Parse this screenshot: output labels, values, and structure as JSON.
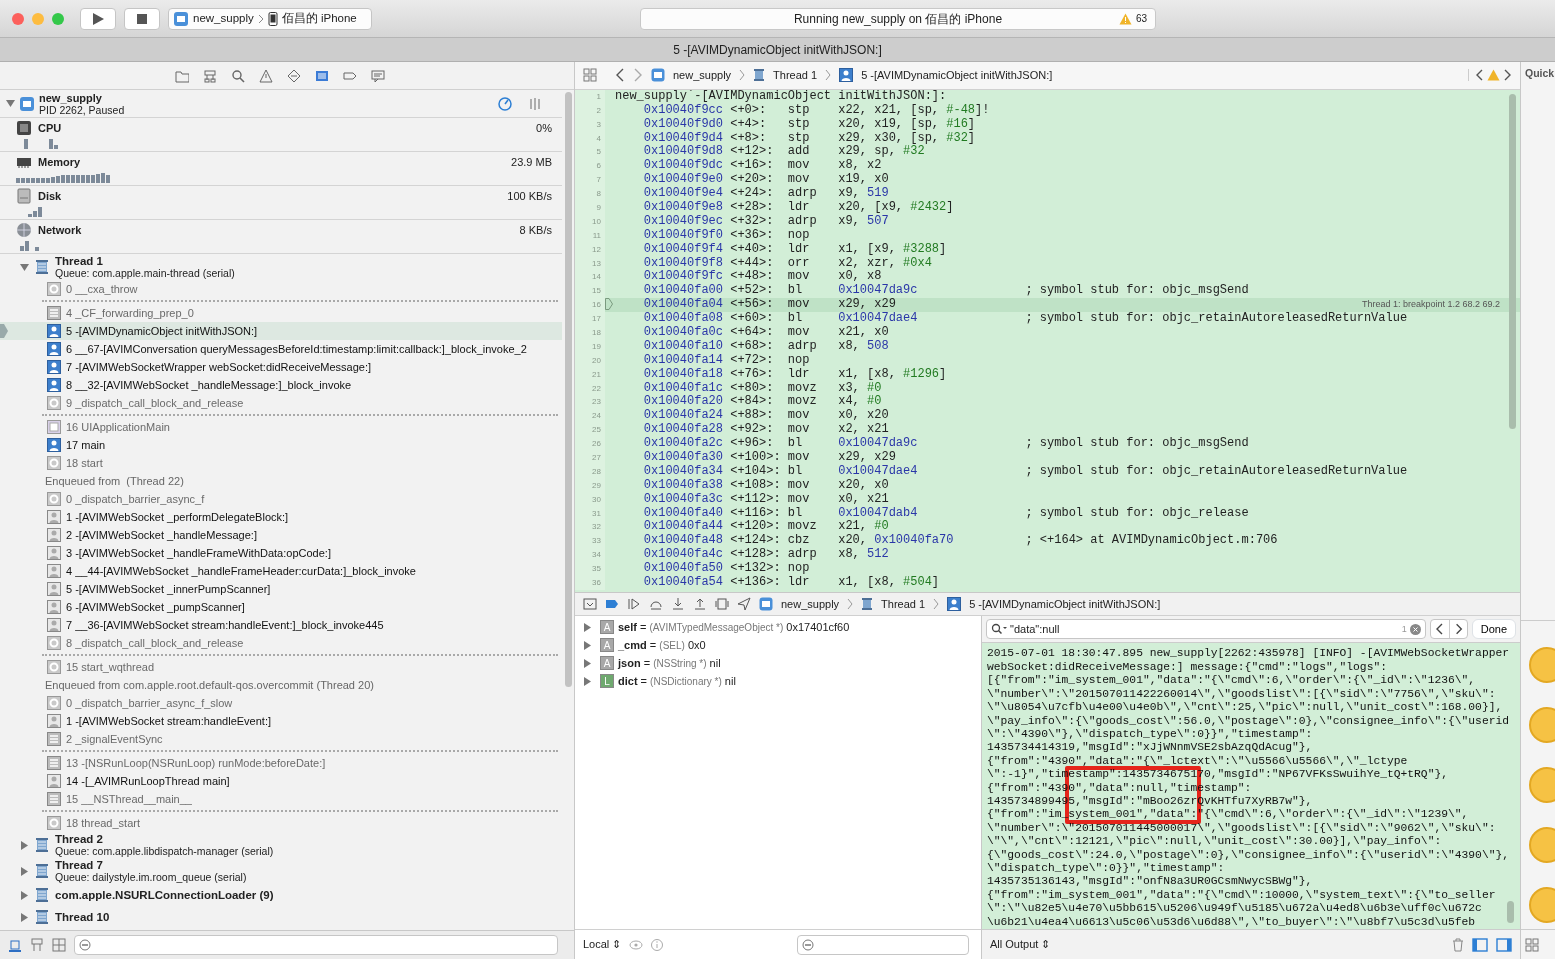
{
  "toolbar": {
    "scheme": "new_supply",
    "device": "佰昌的 iPhone",
    "activity": "Running new_supply on 佰昌的 iPhone",
    "warning_count": "63"
  },
  "tab_title": "5 -[AVIMDynamicObject initWithJSON:]",
  "navigator": {
    "process": {
      "name": "new_supply",
      "status": "PID 2262, Paused",
      "expanded": true
    },
    "gauges": [
      {
        "kind": "cpu",
        "label": "CPU",
        "reading": "0%"
      },
      {
        "kind": "memory",
        "label": "Memory",
        "reading": "23.9 MB"
      },
      {
        "kind": "disk",
        "label": "Disk",
        "reading": "100 KB/s"
      },
      {
        "kind": "network",
        "label": "Network",
        "reading": "8 KB/s"
      }
    ],
    "threads": [
      {
        "title": "Thread 1",
        "queue": "Queue: com.apple.main-thread (serial)",
        "expanded": true,
        "sections": [
          {
            "frames": [
              {
                "label": "0 __cxa_throw",
                "kind": "system",
                "selected": false,
                "gap_before": false
              },
              {
                "label": "4 _CF_forwarding_prep_0",
                "kind": "framework",
                "selected": false,
                "gap_before": true
              },
              {
                "label": "5 -[AVIMDynamicObject initWithJSON:]",
                "kind": "user",
                "selected": true,
                "gap_before": false
              },
              {
                "label": "6 __67-[AVIMConversation queryMessagesBeforeId:timestamp:limit:callback:]_block_invoke_2",
                "kind": "user",
                "selected": false,
                "gap_before": false
              },
              {
                "label": "7 -[AVIMWebSocketWrapper webSocket:didReceiveMessage:]",
                "kind": "user",
                "selected": false,
                "gap_before": false
              },
              {
                "label": "8 __32-[AVIMWebSocket _handleMessage:]_block_invoke",
                "kind": "user",
                "selected": false,
                "gap_before": false
              },
              {
                "label": "9 _dispatch_call_block_and_release",
                "kind": "system",
                "selected": false,
                "gap_before": false
              },
              {
                "label": "16 UIApplicationMain",
                "kind": "app",
                "selected": false,
                "gap_before": true
              },
              {
                "label": "17 main",
                "kind": "user",
                "selected": false,
                "gap_before": false
              },
              {
                "label": "18 start",
                "kind": "system",
                "selected": false,
                "gap_before": false
              }
            ]
          },
          {
            "heading": "Enqueued from  (Thread 22)",
            "frames": [
              {
                "label": "0 _dispatch_barrier_async_f",
                "kind": "system",
                "selected": false,
                "gap_before": false
              },
              {
                "label": "1 -[AVIMWebSocket _performDelegateBlock:]",
                "kind": "user",
                "selected": false,
                "gap_before": false
              },
              {
                "label": "2 -[AVIMWebSocket _handleMessage:]",
                "kind": "user",
                "selected": false,
                "gap_before": false
              },
              {
                "label": "3 -[AVIMWebSocket _handleFrameWithData:opCode:]",
                "kind": "user",
                "selected": false,
                "gap_before": false
              },
              {
                "label": "4 __44-[AVIMWebSocket _handleFrameHeader:curData:]_block_invoke",
                "kind": "user",
                "selected": false,
                "gap_before": false
              },
              {
                "label": "5 -[AVIMWebSocket _innerPumpScanner]",
                "kind": "user",
                "selected": false,
                "gap_before": false
              },
              {
                "label": "6 -[AVIMWebSocket _pumpScanner]",
                "kind": "user",
                "selected": false,
                "gap_before": false
              },
              {
                "label": "7 __36-[AVIMWebSocket stream:handleEvent:]_block_invoke445",
                "kind": "user",
                "selected": false,
                "gap_before": false
              },
              {
                "label": "8 _dispatch_call_block_and_release",
                "kind": "system",
                "selected": false,
                "gap_before": false
              },
              {
                "label": "15 start_wqthread",
                "kind": "system",
                "selected": false,
                "gap_before": true
              }
            ]
          },
          {
            "heading": "Enqueued from com.apple.root.default-qos.overcommit (Thread 20)",
            "frames": [
              {
                "label": "0 _dispatch_barrier_async_f_slow",
                "kind": "system",
                "selected": false,
                "gap_before": false
              },
              {
                "label": "1 -[AVIMWebSocket stream:handleEvent:]",
                "kind": "user",
                "selected": false,
                "gap_before": false
              },
              {
                "label": "2 _signalEventSync",
                "kind": "framework",
                "selected": false,
                "gap_before": false
              },
              {
                "label": "13 -[NSRunLoop(NSRunLoop) runMode:beforeDate:]",
                "kind": "framework",
                "selected": false,
                "gap_before": true
              },
              {
                "label": "14 -[_AVIMRunLoopThread main]",
                "kind": "user",
                "selected": false,
                "gap_before": false
              },
              {
                "label": "15 __NSThread__main__",
                "kind": "framework",
                "selected": false,
                "gap_before": false
              },
              {
                "label": "18 thread_start",
                "kind": "system",
                "selected": false,
                "gap_before": true
              }
            ]
          }
        ]
      },
      {
        "title": "Thread 2",
        "queue": "Queue: com.apple.libdispatch-manager (serial)",
        "expanded": false
      },
      {
        "title": "Thread 7",
        "queue": "Queue: dailystyle.im.room_queue (serial)",
        "expanded": false
      },
      {
        "title": "com.apple.NSURLConnectionLoader (9)",
        "expanded": false
      },
      {
        "title": "Thread 10",
        "expanded": false
      }
    ]
  },
  "jump_bar": [
    "new_supply",
    "Thread 1",
    "5 -[AVIMDynamicObject initWithJSON:]"
  ],
  "disassembly": {
    "lines": [
      {
        "n": "1",
        "kind": "label",
        "text": "new_supply`-[AVIMDynamicObject initWithJSON:]:",
        "current": false
      },
      {
        "n": "2",
        "kind": "instr",
        "addr": "0x10040f9cc",
        "off": "<+0>:",
        "op": "stp",
        "args": "x22, x21, [sp, #-48]!",
        "current": false
      },
      {
        "n": "3",
        "kind": "instr",
        "addr": "0x10040f9d0",
        "off": "<+4>:",
        "op": "stp",
        "args": "x20, x19, [sp, #16]",
        "current": false
      },
      {
        "n": "4",
        "kind": "instr",
        "addr": "0x10040f9d4",
        "off": "<+8>:",
        "op": "stp",
        "args": "x29, x30, [sp, #32]",
        "current": false
      },
      {
        "n": "5",
        "kind": "instr",
        "addr": "0x10040f9d8",
        "off": "<+12>:",
        "op": "add",
        "args": "x29, sp, #32",
        "current": false
      },
      {
        "n": "6",
        "kind": "instr",
        "addr": "0x10040f9dc",
        "off": "<+16>:",
        "op": "mov",
        "args": "x8, x2",
        "current": false
      },
      {
        "n": "7",
        "kind": "instr",
        "addr": "0x10040f9e0",
        "off": "<+20>:",
        "op": "mov",
        "args": "x19, x0",
        "current": false
      },
      {
        "n": "8",
        "kind": "instr",
        "addr": "0x10040f9e4",
        "off": "<+24>:",
        "op": "adrp",
        "args": "x9, 519",
        "current": false
      },
      {
        "n": "9",
        "kind": "instr",
        "addr": "0x10040f9e8",
        "off": "<+28>:",
        "op": "ldr",
        "args": "x20, [x9, #2432]",
        "current": false
      },
      {
        "n": "10",
        "kind": "instr",
        "addr": "0x10040f9ec",
        "off": "<+32>:",
        "op": "adrp",
        "args": "x9, 507",
        "current": false
      },
      {
        "n": "11",
        "kind": "instr",
        "addr": "0x10040f9f0",
        "off": "<+36>:",
        "op": "nop",
        "current": false
      },
      {
        "n": "12",
        "kind": "instr",
        "addr": "0x10040f9f4",
        "off": "<+40>:",
        "op": "ldr",
        "args": "x1, [x9, #3288]",
        "current": false
      },
      {
        "n": "13",
        "kind": "instr",
        "addr": "0x10040f9f8",
        "off": "<+44>:",
        "op": "orr",
        "args": "x2, xzr, #0x4",
        "current": false
      },
      {
        "n": "14",
        "kind": "instr",
        "addr": "0x10040f9fc",
        "off": "<+48>:",
        "op": "mov",
        "args": "x0, x8",
        "current": false
      },
      {
        "n": "15",
        "kind": "instr",
        "addr": "0x10040fa00",
        "off": "<+52>:",
        "op": "bl",
        "args": "0x10047da9c",
        "comment": "; symbol stub for: objc_msgSend",
        "current": false
      },
      {
        "n": "16",
        "kind": "instr",
        "addr": "0x10040fa04",
        "off": "<+56>:",
        "op": "mov",
        "args": "x29, x29",
        "current": true,
        "annotation": "Thread 1: breakpoint 1.2 68.2 69.2"
      },
      {
        "n": "17",
        "kind": "instr",
        "addr": "0x10040fa08",
        "off": "<+60>:",
        "op": "bl",
        "args": "0x10047dae4",
        "comment": "; symbol stub for: objc_retainAutoreleasedReturnValue",
        "current": false
      },
      {
        "n": "18",
        "kind": "instr",
        "addr": "0x10040fa0c",
        "off": "<+64>:",
        "op": "mov",
        "args": "x21, x0",
        "current": false
      },
      {
        "n": "19",
        "kind": "instr",
        "addr": "0x10040fa10",
        "off": "<+68>:",
        "op": "adrp",
        "args": "x8, 508",
        "current": false
      },
      {
        "n": "20",
        "kind": "instr",
        "addr": "0x10040fa14",
        "off": "<+72>:",
        "op": "nop",
        "current": false
      },
      {
        "n": "21",
        "kind": "instr",
        "addr": "0x10040fa18",
        "off": "<+76>:",
        "op": "ldr",
        "args": "x1, [x8, #1296]",
        "current": false
      },
      {
        "n": "22",
        "kind": "instr",
        "addr": "0x10040fa1c",
        "off": "<+80>:",
        "op": "movz",
        "args": "x3, #0",
        "current": false
      },
      {
        "n": "23",
        "kind": "instr",
        "addr": "0x10040fa20",
        "off": "<+84>:",
        "op": "movz",
        "args": "x4, #0",
        "current": false
      },
      {
        "n": "24",
        "kind": "instr",
        "addr": "0x10040fa24",
        "off": "<+88>:",
        "op": "mov",
        "args": "x0, x20",
        "current": false
      },
      {
        "n": "25",
        "kind": "instr",
        "addr": "0x10040fa28",
        "off": "<+92>:",
        "op": "mov",
        "args": "x2, x21",
        "current": false
      },
      {
        "n": "26",
        "kind": "instr",
        "addr": "0x10040fa2c",
        "off": "<+96>:",
        "op": "bl",
        "args": "0x10047da9c",
        "comment": "; symbol stub for: objc_msgSend",
        "current": false
      },
      {
        "n": "27",
        "kind": "instr",
        "addr": "0x10040fa30",
        "off": "<+100>:",
        "op": "mov",
        "args": "x29, x29",
        "current": false
      },
      {
        "n": "28",
        "kind": "instr",
        "addr": "0x10040fa34",
        "off": "<+104>:",
        "op": "bl",
        "args": "0x10047dae4",
        "comment": "; symbol stub for: objc_retainAutoreleasedReturnValue",
        "current": false
      },
      {
        "n": "29",
        "kind": "instr",
        "addr": "0x10040fa38",
        "off": "<+108>:",
        "op": "mov",
        "args": "x20, x0",
        "current": false
      },
      {
        "n": "30",
        "kind": "instr",
        "addr": "0x10040fa3c",
        "off": "<+112>:",
        "op": "mov",
        "args": "x0, x21",
        "current": false
      },
      {
        "n": "31",
        "kind": "instr",
        "addr": "0x10040fa40",
        "off": "<+116>:",
        "op": "bl",
        "args": "0x10047dab4",
        "comment": "; symbol stub for: objc_release",
        "current": false
      },
      {
        "n": "32",
        "kind": "instr",
        "addr": "0x10040fa44",
        "off": "<+120>:",
        "op": "movz",
        "args": "x21, #0",
        "current": false
      },
      {
        "n": "33",
        "kind": "instr",
        "addr": "0x10040fa48",
        "off": "<+124>:",
        "op": "cbz",
        "args": "x20, 0x10040fa70",
        "comment": "; <+164> at AVIMDynamicObject.m:706",
        "current": false
      },
      {
        "n": "34",
        "kind": "instr",
        "addr": "0x10040fa4c",
        "off": "<+128>:",
        "op": "adrp",
        "args": "x8, 512",
        "current": false
      },
      {
        "n": "35",
        "kind": "instr",
        "addr": "0x10040fa50",
        "off": "<+132>:",
        "op": "nop",
        "current": false
      },
      {
        "n": "36",
        "kind": "instr",
        "addr": "0x10040fa54",
        "off": "<+136>:",
        "op": "ldr",
        "args": "x1, [x8, #504]",
        "current": false
      }
    ]
  },
  "debug_bar": {
    "path": [
      "new_supply",
      "Thread 1",
      "5 -[AVIMDynamicObject initWithJSON:]"
    ]
  },
  "variables": [
    {
      "kind": "argument",
      "badge": "A",
      "name": "self",
      "assign": "=",
      "type": "(AVIMTypedMessageObject *)",
      "value": "0x17401cf60"
    },
    {
      "kind": "argument",
      "badge": "A",
      "name": "_cmd",
      "assign": "=",
      "type": "(SEL)",
      "value": "0x0"
    },
    {
      "kind": "argument",
      "badge": "A",
      "name": "json",
      "assign": "=",
      "type": "(NSString *)",
      "value": "nil"
    },
    {
      "kind": "local",
      "badge": "L",
      "name": "dict",
      "assign": "=",
      "type": "(NSDictionary *)",
      "value": "nil"
    }
  ],
  "variables_scope": "Local ⇕",
  "console": {
    "search": "\"data\":null",
    "match_count": "1",
    "done": "Done",
    "output_filter": "All Output ⇕",
    "lines": [
      "2015-07-01 18:30:47.895 new_supply[2262:435978] [INFO] -[AVIMWebSocketWrapper",
      "webSocket:didReceiveMessage:] message:{\"cmd\":\"logs\",\"logs\":",
      "[{\"from\":\"im_system_001\",\"data\":\"{\\\"cmd\\\":6,\\\"order\\\":{\\\"_id\\\":\\\"1236\\\",",
      "\\\"number\\\":\\\"201507011422260014\\\",\\\"goodslist\\\":[{\\\"sid\\\":\\\"7756\\\",\\\"sku\\\":",
      "\\\"\\u8054\\u7cfb\\u4e00\\u4e0b\\\",\\\"cnt\\\":25,\\\"pic\\\":null,\\\"unit_cost\\\":168.00}],",
      "\\\"pay_info\\\":{\\\"goods_cost\\\":56.0,\\\"postage\\\":0},\\\"consignee_info\\\":{\\\"userid",
      "\\\":\\\"4390\\\"},\\\"dispatch_type\\\":0}}\",\"timestamp\":",
      "1435734414319,\"msgId\":\"xJjWNnmVSE2sbAzqQdAcug\"},",
      "{\"from\":\"4390\",\"data\":\"{\\\"_lctext\\\":\\\"\\u5566\\u5566\\\",\\\"_lctype",
      "\\\":-1}\",\"timestamp\":1435734675170,\"msgId\":\"NP67VFKsSwuihYe_tQ+tRQ\"},",
      "{\"from\":\"4390\",\"data\":null,\"timestamp\":",
      "1435734899495,\"msgId\":\"mBoo26zrQvKHTfu7XyRB7w\"},",
      "{\"from\":\"im_system_001\",\"data\":\"{\\\"cmd\\\":6,\\\"order\\\":{\\\"_id\\\":\\\"1239\\\",",
      "\\\"number\\\":\\\"201507011445000017\\\",\\\"goodslist\\\":[{\\\"sid\\\":\\\"9062\\\",\\\"sku\\\":",
      "\\\"\\\",\\\"cnt\\\":12121,\\\"pic\\\":null,\\\"unit_cost\\\":30.00}],\\\"pay_info\\\":",
      "{\\\"goods_cost\\\":24.0,\\\"postage\\\":0},\\\"consignee_info\\\":{\\\"userid\\\":\\\"4390\\\"},",
      "\\\"dispatch_type\\\":0}}\",\"timestamp\":",
      "1435735136143,\"msgId\":\"onfN8a3UR0GCsmNwycSBWg\"},",
      "{\"from\":\"im_system_001\",\"data\":\"{\\\"cmd\\\":10000,\\\"system_text\\\":{\\\"to_seller",
      "\\\":\\\"\\u82e5\\u4e70\\u5bb615\\u5206\\u949f\\u5185\\u672a\\u4ed8\\u6b3e\\uff0c\\u672c",
      "\\u6b21\\u4ea4\\u6613\\u5c06\\u53d6\\u6d88\\\",\\\"to_buyer\\\":\\\"\\u8bf7\\u5c3d\\u5feb"
    ]
  },
  "utility": {
    "title": "Quick"
  }
}
